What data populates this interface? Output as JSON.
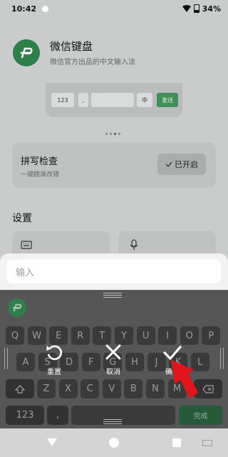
{
  "status_bar": {
    "time": "10:42",
    "battery": "34%"
  },
  "app": {
    "title": "微信键盘",
    "subtitle": "微信官方出品的中文输入法"
  },
  "preview_keys": {
    "k123": "123",
    "comma": ",",
    "zh": "中",
    "send": "发送"
  },
  "spell_check": {
    "title": "拼写检查",
    "subtitle": "一键精准改错",
    "status": "已开启"
  },
  "settings": {
    "label": "设置"
  },
  "input": {
    "placeholder": "输入"
  },
  "keyboard": {
    "row1": [
      "Q",
      "W",
      "E",
      "R",
      "T",
      "Y",
      "U",
      "I",
      "O",
      "P"
    ],
    "row2": [
      "A",
      "S",
      "D",
      "F",
      "G",
      "H",
      "J",
      "K",
      "L"
    ],
    "row3": [
      "Z",
      "X",
      "C",
      "V",
      "B",
      "N",
      "M"
    ],
    "num_label": "123",
    "comma": ",",
    "done_label": "完成"
  },
  "overlay": {
    "reset": "重置",
    "cancel": "取消",
    "confirm": "确定"
  },
  "colors": {
    "brand_green": "#2e7f4a",
    "arrow_red": "#e3141b"
  }
}
